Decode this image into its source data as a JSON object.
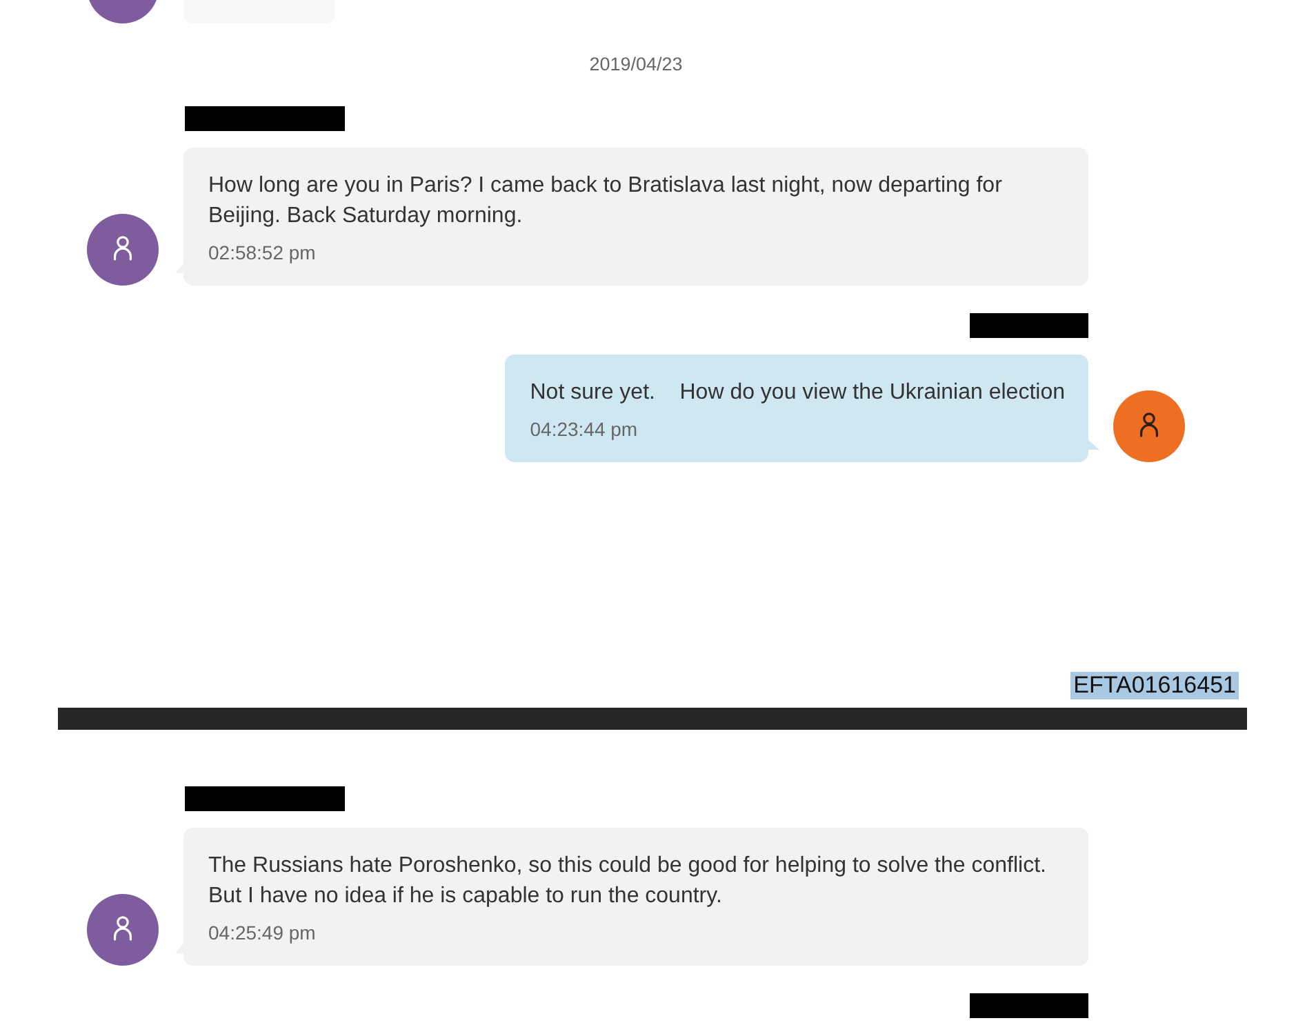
{
  "pages": [
    {
      "items": [
        {
          "kind": "partial_message",
          "outgoing": false
        },
        {
          "kind": "date",
          "text": "2019/04/23"
        },
        {
          "kind": "redaction",
          "outgoing": false
        },
        {
          "kind": "message",
          "outgoing": false,
          "text": "How long are you in Paris? I came back to Bratislava last night, now departing for\nBeijing. Back Saturday morning.",
          "time": "02:58:52 pm"
        },
        {
          "kind": "redaction",
          "outgoing": true
        },
        {
          "kind": "message",
          "outgoing": true,
          "text": "Not sure yet.    How do you view the Ukrainian election",
          "time": "04:23:44 pm"
        }
      ],
      "document_id": "EFTA01616451"
    },
    {
      "items": [
        {
          "kind": "redaction",
          "outgoing": false
        },
        {
          "kind": "message",
          "outgoing": false,
          "text": "The Russians hate Poroshenko, so this could be good for helping to solve the conflict.\nBut I have no idea if he is capable to run the country.",
          "time": "04:25:49 pm"
        },
        {
          "kind": "redaction",
          "outgoing": true
        }
      ]
    }
  ]
}
